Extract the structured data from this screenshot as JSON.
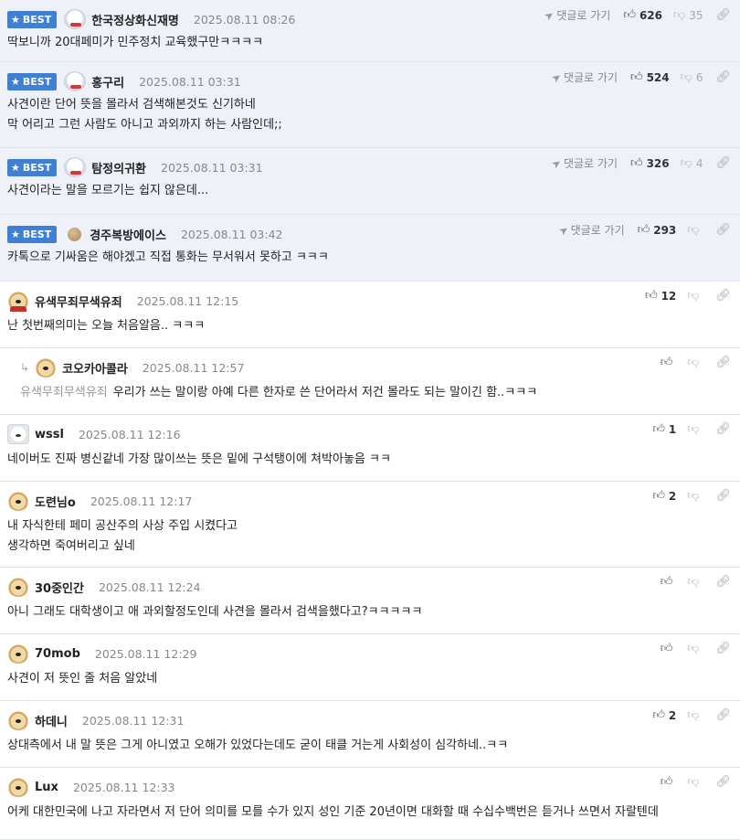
{
  "ui": {
    "best_label": "BEST",
    "goto_label": "댓글로 가기"
  },
  "comments": [
    {
      "best": true,
      "avatar": "polar",
      "nick": "한국정상화신재명",
      "date": "2025.08.11 08:26",
      "lines": [
        "딱보니까 20대페미가 민주정치 교육했구만ㅋㅋㅋㅋ"
      ],
      "likes": "626",
      "dislikes": "35",
      "goto": true
    },
    {
      "best": true,
      "avatar": "polar",
      "nick": "홍구리",
      "date": "2025.08.11 03:31",
      "lines": [
        "사견이란 단어 뜻을 몰라서 검색해본것도 신기하네",
        "막 어리고 그런 사람도 아니고 과외까지 하는 사람인데;;"
      ],
      "likes": "524",
      "dislikes": "6",
      "goto": true
    },
    {
      "best": true,
      "avatar": "polar",
      "nick": "탐정의귀환",
      "date": "2025.08.11 03:31",
      "lines": [
        "사견이라는 말을 모르기는 쉽지 않은데..."
      ],
      "likes": "326",
      "dislikes": "4",
      "goto": true
    },
    {
      "best": true,
      "avatar": "ball",
      "nick": "경주복방에이스",
      "date": "2025.08.11 03:42",
      "lines": [
        "카톡으로 기싸움은 해야겠고 직접 통화는 무서워서 못하고 ㅋㅋㅋ"
      ],
      "likes": "293",
      "dislikes": "",
      "goto": true
    },
    {
      "best": false,
      "avatar": "dog-red",
      "nick": "유색무죄무색유죄",
      "date": "2025.08.11 12:15",
      "lines": [
        "난 첫번째의미는 오늘 처음알음.. ㅋㅋㅋ"
      ],
      "likes": "12",
      "dislikes": ""
    },
    {
      "best": false,
      "reply": true,
      "reply_to": "유색무죄무색유죄",
      "avatar": "dog",
      "nick": "코오카아콜라",
      "date": "2025.08.11 12:57",
      "lines": [
        "우리가 쓰는 말이랑 아예 다른 한자로 쓴 단어라서 저건 몰라도 되는 말이긴 함..ㅋㅋㅋ"
      ],
      "likes": "",
      "dislikes": ""
    },
    {
      "best": false,
      "avatar": "white",
      "nick": "wssl",
      "date": "2025.08.11 12:16",
      "lines": [
        "네이버도 진짜 병신같네 가장 많이쓰는 뜻은 밑에 구석탱이에 쳐박아놓음 ㅋㅋ"
      ],
      "likes": "1",
      "dislikes": ""
    },
    {
      "best": false,
      "avatar": "dog",
      "nick": "도련님o",
      "date": "2025.08.11 12:17",
      "lines": [
        "내 자식한테 페미 공산주의 사상 주입 시켰다고",
        "생각하면 죽여버리고 싶네"
      ],
      "likes": "2",
      "dislikes": ""
    },
    {
      "best": false,
      "avatar": "dog",
      "nick": "30중인간",
      "date": "2025.08.11 12:24",
      "lines": [
        "아니 그래도 대학생이고 애 과외할정도인데 사견을 몰라서 검색을했다고?ㅋㅋㅋㅋㅋ"
      ],
      "likes": "",
      "dislikes": ""
    },
    {
      "best": false,
      "avatar": "dog",
      "nick": "70mob",
      "date": "2025.08.11 12:29",
      "lines": [
        "사견이 저 뜻인 줄 처음 알았네"
      ],
      "likes": "",
      "dislikes": ""
    },
    {
      "best": false,
      "avatar": "dog",
      "nick": "하데니",
      "date": "2025.08.11 12:31",
      "lines": [
        "상대측에서 내 말 뜻은 그게 아니였고 오해가 있었다는데도 굳이 태클 거는게 사회성이 심각하네..ㅋㅋ"
      ],
      "likes": "2",
      "dislikes": ""
    },
    {
      "best": false,
      "avatar": "dog",
      "nick": "Lux",
      "date": "2025.08.11 12:33",
      "lines": [
        "어케 대한민국에 나고 자라면서 저 단어 의미를 모를 수가 있지 성인 기준 20년이면 대화할 때 수십수백번은 듣거나 쓰면서 자랄텐데"
      ],
      "likes": "",
      "dislikes": ""
    }
  ]
}
